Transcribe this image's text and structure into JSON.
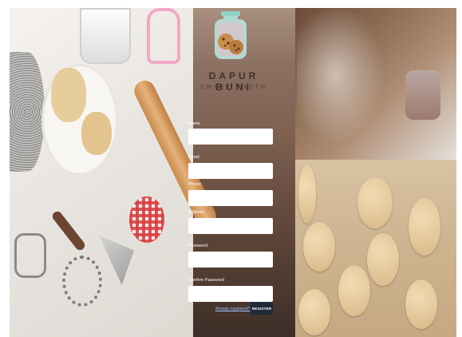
{
  "brand": {
    "title": "DAPUR BUNI",
    "subtitle": "SWEET TOOTH"
  },
  "form": {
    "fields": [
      {
        "label": "Name",
        "value": ""
      },
      {
        "label": "Email",
        "value": ""
      },
      {
        "label": "Phone",
        "value": ""
      },
      {
        "label": "Address",
        "value": ""
      },
      {
        "label": "Password",
        "value": ""
      },
      {
        "label": "Confirm Password",
        "value": ""
      }
    ],
    "login_link": "Already registered?",
    "register_label": "REGISTER"
  },
  "colors": {
    "logo_teal": "#8fd3c7",
    "logo_pink": "#f3b2c4",
    "cookie": "#c98d4c",
    "button": "#1f2a3a"
  },
  "icons": {
    "logo": "cookie-jar-icon"
  }
}
